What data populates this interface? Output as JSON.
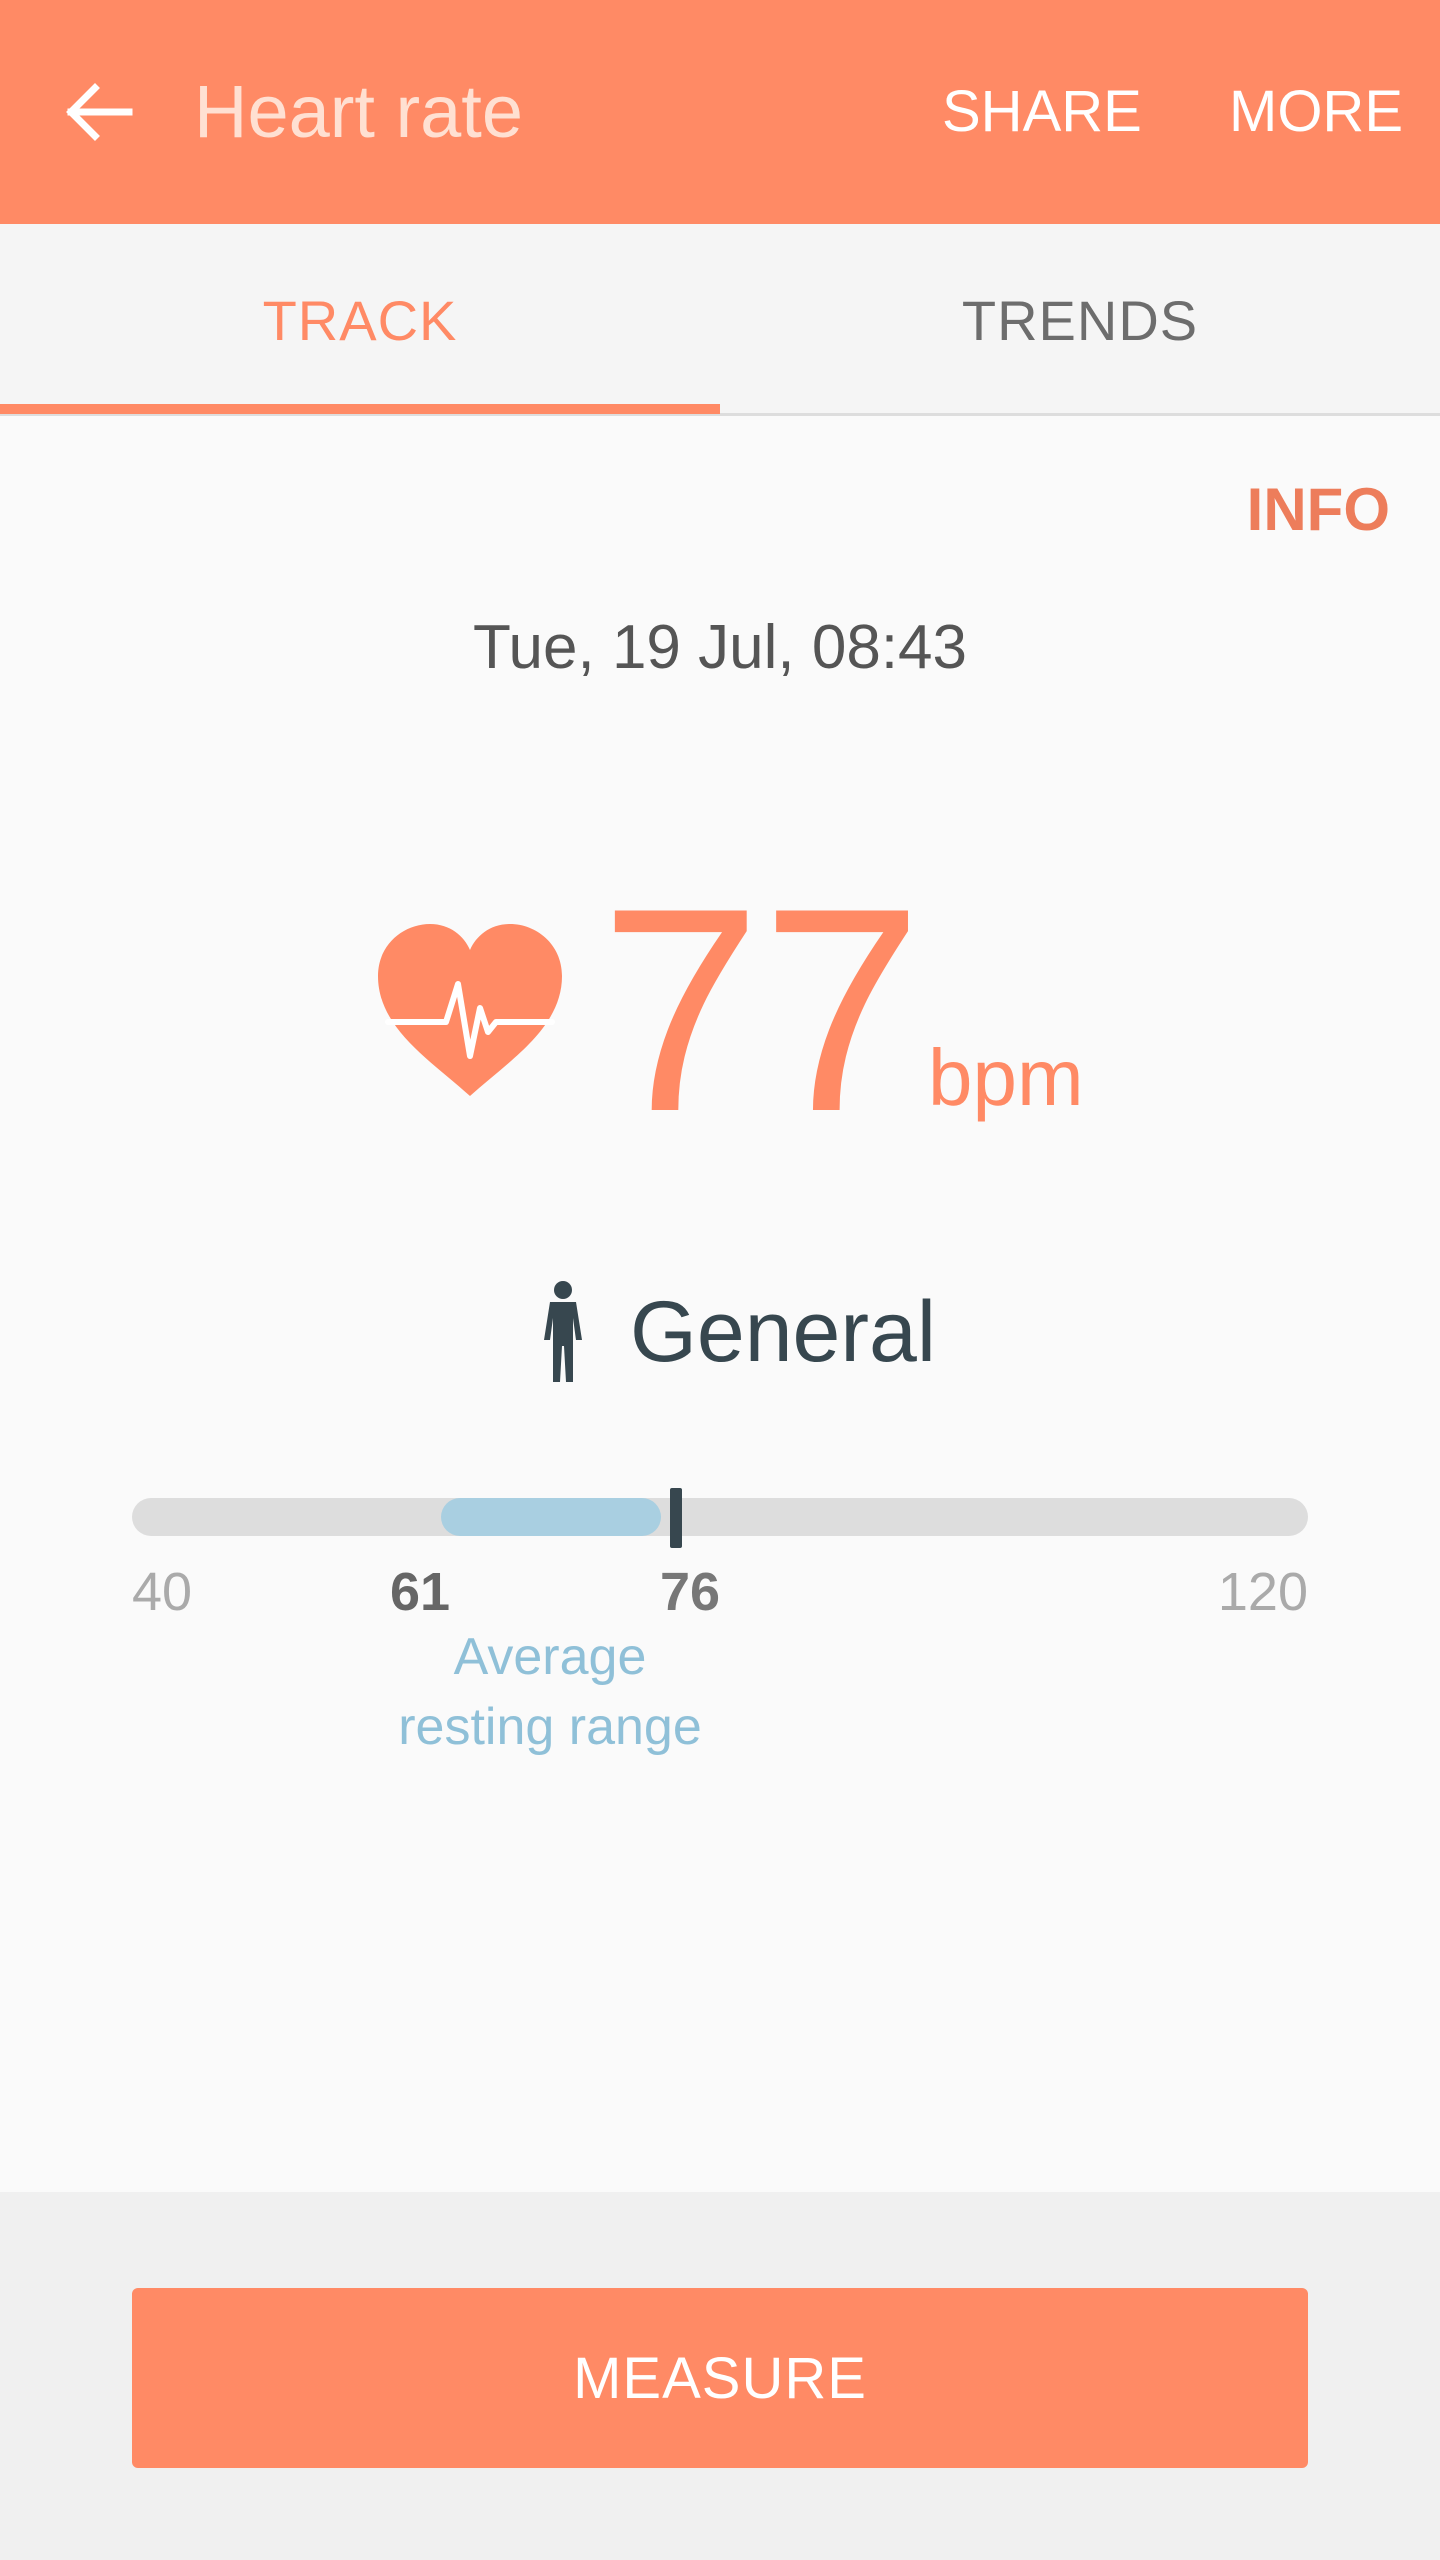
{
  "app_bar": {
    "title": "Heart rate",
    "back_icon": "arrow-left-icon",
    "actions": {
      "share": "SHARE",
      "more": "MORE"
    },
    "color": "#ff8a65"
  },
  "tabs": {
    "items": [
      {
        "label": "TRACK",
        "active": true
      },
      {
        "label": "TRENDS",
        "active": false
      }
    ]
  },
  "info_label": "INFO",
  "measurement": {
    "timestamp": "Tue, 19 Jul, 08:43",
    "heart_icon": "heart-pulse-icon",
    "value": "77",
    "unit": "bpm"
  },
  "profile": {
    "icon": "person-icon",
    "label": "General"
  },
  "gauge": {
    "min_label": "40",
    "range_low_label": "61",
    "range_high_label": "76",
    "max_label": "120",
    "range_caption_line1": "Average",
    "range_caption_line2": "resting range",
    "min": 40,
    "max": 120,
    "range_low": 61,
    "range_high": 76,
    "current": 77,
    "range_color": "#a9cfe1",
    "marker_color": "#37474f"
  },
  "measure_button": "MEASURE"
}
